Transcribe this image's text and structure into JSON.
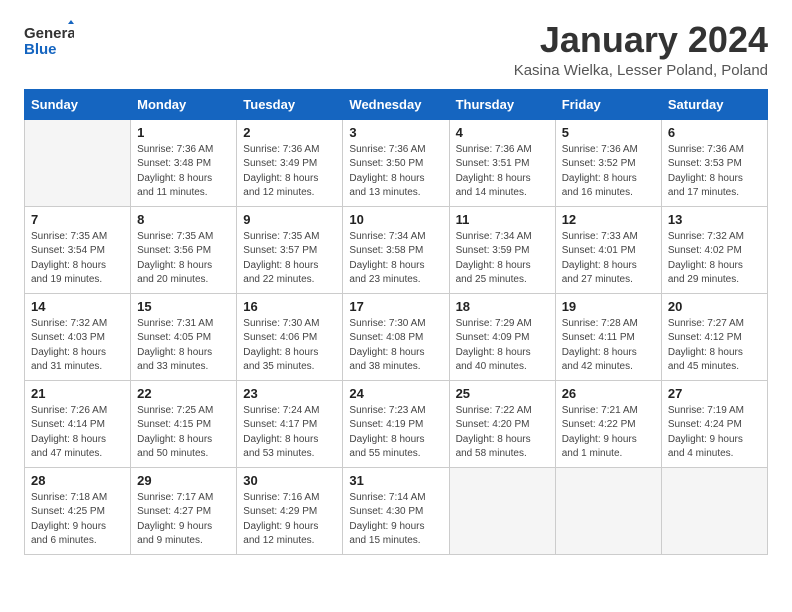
{
  "logo": {
    "general": "General",
    "blue": "Blue"
  },
  "title": "January 2024",
  "subtitle": "Kasina Wielka, Lesser Poland, Poland",
  "weekdays": [
    "Sunday",
    "Monday",
    "Tuesday",
    "Wednesday",
    "Thursday",
    "Friday",
    "Saturday"
  ],
  "weeks": [
    [
      {
        "day": "",
        "sunrise": "",
        "sunset": "",
        "daylight": "",
        "empty": true
      },
      {
        "day": "1",
        "sunrise": "Sunrise: 7:36 AM",
        "sunset": "Sunset: 3:48 PM",
        "daylight": "Daylight: 8 hours and 11 minutes."
      },
      {
        "day": "2",
        "sunrise": "Sunrise: 7:36 AM",
        "sunset": "Sunset: 3:49 PM",
        "daylight": "Daylight: 8 hours and 12 minutes."
      },
      {
        "day": "3",
        "sunrise": "Sunrise: 7:36 AM",
        "sunset": "Sunset: 3:50 PM",
        "daylight": "Daylight: 8 hours and 13 minutes."
      },
      {
        "day": "4",
        "sunrise": "Sunrise: 7:36 AM",
        "sunset": "Sunset: 3:51 PM",
        "daylight": "Daylight: 8 hours and 14 minutes."
      },
      {
        "day": "5",
        "sunrise": "Sunrise: 7:36 AM",
        "sunset": "Sunset: 3:52 PM",
        "daylight": "Daylight: 8 hours and 16 minutes."
      },
      {
        "day": "6",
        "sunrise": "Sunrise: 7:36 AM",
        "sunset": "Sunset: 3:53 PM",
        "daylight": "Daylight: 8 hours and 17 minutes."
      }
    ],
    [
      {
        "day": "7",
        "sunrise": "Sunrise: 7:35 AM",
        "sunset": "Sunset: 3:54 PM",
        "daylight": "Daylight: 8 hours and 19 minutes."
      },
      {
        "day": "8",
        "sunrise": "Sunrise: 7:35 AM",
        "sunset": "Sunset: 3:56 PM",
        "daylight": "Daylight: 8 hours and 20 minutes."
      },
      {
        "day": "9",
        "sunrise": "Sunrise: 7:35 AM",
        "sunset": "Sunset: 3:57 PM",
        "daylight": "Daylight: 8 hours and 22 minutes."
      },
      {
        "day": "10",
        "sunrise": "Sunrise: 7:34 AM",
        "sunset": "Sunset: 3:58 PM",
        "daylight": "Daylight: 8 hours and 23 minutes."
      },
      {
        "day": "11",
        "sunrise": "Sunrise: 7:34 AM",
        "sunset": "Sunset: 3:59 PM",
        "daylight": "Daylight: 8 hours and 25 minutes."
      },
      {
        "day": "12",
        "sunrise": "Sunrise: 7:33 AM",
        "sunset": "Sunset: 4:01 PM",
        "daylight": "Daylight: 8 hours and 27 minutes."
      },
      {
        "day": "13",
        "sunrise": "Sunrise: 7:32 AM",
        "sunset": "Sunset: 4:02 PM",
        "daylight": "Daylight: 8 hours and 29 minutes."
      }
    ],
    [
      {
        "day": "14",
        "sunrise": "Sunrise: 7:32 AM",
        "sunset": "Sunset: 4:03 PM",
        "daylight": "Daylight: 8 hours and 31 minutes."
      },
      {
        "day": "15",
        "sunrise": "Sunrise: 7:31 AM",
        "sunset": "Sunset: 4:05 PM",
        "daylight": "Daylight: 8 hours and 33 minutes."
      },
      {
        "day": "16",
        "sunrise": "Sunrise: 7:30 AM",
        "sunset": "Sunset: 4:06 PM",
        "daylight": "Daylight: 8 hours and 35 minutes."
      },
      {
        "day": "17",
        "sunrise": "Sunrise: 7:30 AM",
        "sunset": "Sunset: 4:08 PM",
        "daylight": "Daylight: 8 hours and 38 minutes."
      },
      {
        "day": "18",
        "sunrise": "Sunrise: 7:29 AM",
        "sunset": "Sunset: 4:09 PM",
        "daylight": "Daylight: 8 hours and 40 minutes."
      },
      {
        "day": "19",
        "sunrise": "Sunrise: 7:28 AM",
        "sunset": "Sunset: 4:11 PM",
        "daylight": "Daylight: 8 hours and 42 minutes."
      },
      {
        "day": "20",
        "sunrise": "Sunrise: 7:27 AM",
        "sunset": "Sunset: 4:12 PM",
        "daylight": "Daylight: 8 hours and 45 minutes."
      }
    ],
    [
      {
        "day": "21",
        "sunrise": "Sunrise: 7:26 AM",
        "sunset": "Sunset: 4:14 PM",
        "daylight": "Daylight: 8 hours and 47 minutes."
      },
      {
        "day": "22",
        "sunrise": "Sunrise: 7:25 AM",
        "sunset": "Sunset: 4:15 PM",
        "daylight": "Daylight: 8 hours and 50 minutes."
      },
      {
        "day": "23",
        "sunrise": "Sunrise: 7:24 AM",
        "sunset": "Sunset: 4:17 PM",
        "daylight": "Daylight: 8 hours and 53 minutes."
      },
      {
        "day": "24",
        "sunrise": "Sunrise: 7:23 AM",
        "sunset": "Sunset: 4:19 PM",
        "daylight": "Daylight: 8 hours and 55 minutes."
      },
      {
        "day": "25",
        "sunrise": "Sunrise: 7:22 AM",
        "sunset": "Sunset: 4:20 PM",
        "daylight": "Daylight: 8 hours and 58 minutes."
      },
      {
        "day": "26",
        "sunrise": "Sunrise: 7:21 AM",
        "sunset": "Sunset: 4:22 PM",
        "daylight": "Daylight: 9 hours and 1 minute."
      },
      {
        "day": "27",
        "sunrise": "Sunrise: 7:19 AM",
        "sunset": "Sunset: 4:24 PM",
        "daylight": "Daylight: 9 hours and 4 minutes."
      }
    ],
    [
      {
        "day": "28",
        "sunrise": "Sunrise: 7:18 AM",
        "sunset": "Sunset: 4:25 PM",
        "daylight": "Daylight: 9 hours and 6 minutes."
      },
      {
        "day": "29",
        "sunrise": "Sunrise: 7:17 AM",
        "sunset": "Sunset: 4:27 PM",
        "daylight": "Daylight: 9 hours and 9 minutes."
      },
      {
        "day": "30",
        "sunrise": "Sunrise: 7:16 AM",
        "sunset": "Sunset: 4:29 PM",
        "daylight": "Daylight: 9 hours and 12 minutes."
      },
      {
        "day": "31",
        "sunrise": "Sunrise: 7:14 AM",
        "sunset": "Sunset: 4:30 PM",
        "daylight": "Daylight: 9 hours and 15 minutes."
      },
      {
        "day": "",
        "empty": true
      },
      {
        "day": "",
        "empty": true
      },
      {
        "day": "",
        "empty": true
      }
    ]
  ]
}
